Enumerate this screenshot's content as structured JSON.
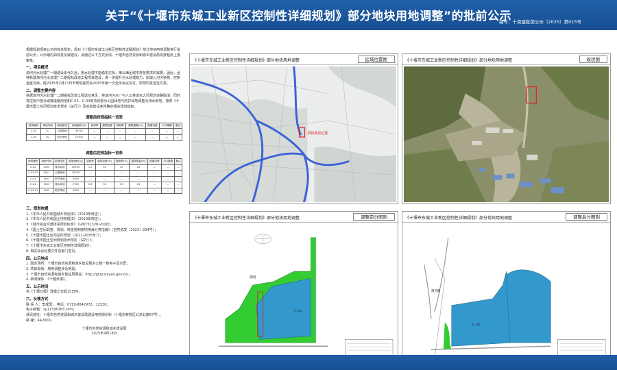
{
  "header": {
    "title": "关于“《十堰市东城工业新区控制性详细规划》部分地块用地调整”的批前公示",
    "doc_no": "编号：十资建批前公示（2025）第015号"
  },
  "left": {
    "intro": "根据规划项目公示的有关规定，现对《十堰市东城工业新区控制性详细规划》部分地块用地调整进行批前公示，公示期内如有意见或建议，请通过以下方式反馈，十堰市自然资源和城乡建设局将按程序上报审批。",
    "s1_title": "一、项目概况",
    "s1_text": "泗河污水处理厂一期建设年代久远，用水处理不能稳定达标，难以满足城市排放要求的需要，因此，亟待新建泗河污水处理厂二期提标改造工程项目建设，进一步提升污水处理能力，削减入河污染物，控制温室污染。经2025年2月17日市规划委员会2025年第一次全体会议议定，原则同意选址方案。",
    "s2_title": "二、调整主要内容",
    "s2_text": "依据泗河污水处理厂二期提标改造工程选址意见，将泗河污水厂与人工林道东之间规划道路取消，同时将控规中部分城镇道路用地和C-03、C-04地块的部分公园绿地与防护绿地调整为排水用地。按照《十堰市国土空间规划技术规定（试行）》及实际建设条件确定相关规划指标。",
    "table1_title": "调整前控规指标一览表",
    "table1_headers": [
      "地块编号",
      "用地代码",
      "用地性质",
      "用地面积(㎡)",
      "容积率",
      "建筑密度",
      "绿地率",
      "建筑限高(m)",
      "配建设施",
      "人口规模",
      "备注"
    ],
    "table1_rows": [
      [
        "C-03",
        "G1",
        "公园绿地",
        "49751",
        "—",
        "—",
        "—",
        "—",
        "—",
        "—",
        "—"
      ],
      [
        "C-04",
        "G2",
        "防护绿地",
        "15302",
        "—",
        "—",
        "—",
        "—",
        "—",
        "—",
        "—"
      ]
    ],
    "table2_title": "调整后控规指标一览表",
    "table2_headers": [
      "地块编号",
      "用地代码",
      "用地性质",
      "用地面积(㎡)",
      "容积率",
      "建筑密度(%)",
      "绿地率(%)",
      "建筑限高(m)",
      "配建设施",
      "人口规模",
      "备注"
    ],
    "table2_rows": [
      [
        "C-02",
        "1303",
        "排水用地",
        "29990",
        "1.0",
        "40",
        "30",
        "24",
        "—",
        "—",
        "—"
      ],
      [
        "C-03-01",
        "1401",
        "公园绿地",
        "32990",
        "—",
        "—",
        "—",
        "—",
        "—",
        "—",
        "—"
      ],
      [
        "C-03",
        "1402",
        "防护绿地",
        "3990",
        "—",
        "—",
        "—",
        "—",
        "—",
        "—",
        "—"
      ],
      [
        "C-04",
        "1303",
        "排水用地",
        "9720",
        "0.8",
        "50",
        "30",
        "24",
        "—",
        "—",
        "—"
      ],
      [
        "C-04-01",
        "1402",
        "防护绿地",
        "5990",
        "—",
        "—",
        "—",
        "—",
        "—",
        "—",
        "—"
      ]
    ],
    "s3_title": "三、规划依据",
    "s3_items": [
      "1.《中华人民共和国城乡规划法》（2019年修正）；",
      "2.《中华人民共和国土地管理法》（2019年修正）；",
      "3.《城市综合交通体系规划标准》（GB/T51328-2018）；",
      "4.《国土空间调查、规划、用途管制用地用海分类指南》（自然资发〔2023〕234号）；",
      "5.《十堰市国土空间总体规划（2021-2035年）》；",
      "6.《十堰市国土空间规划技术规定（试行）》；",
      "7.《十堰市东城工业新区控制性详细规划》；",
      "8. 相关会议纪要文件及部门意见。"
    ],
    "s4_title": "四、公示地点",
    "s4_items": [
      "1. 固定场所：十堰市自然资源和城乡建设局办公楼一楼电子显示屏；",
      "2. 项目现场：用地调整涉及地段；",
      "3. 十堰市自然资源和城乡建设局网站：http://gtzy.shiyan.gov.cn/；",
      "4. 新闻媒体：《十堰日报》。"
    ],
    "s5_title": "五、公示时间",
    "s5_text": "自《十堰日报》登报之日起15日内。",
    "s6_title": "六、反馈方式",
    "s6_items": [
      "联 系 人：李成国；        电话：0719-8642972，12336；",
      "电子邮箱：sy12336163.com；",
      "通讯地址：十堰市自然资源和城乡建设局建设用地规划科（十堰市茅箭区北京北路67号）；",
      "邮    编：442000。"
    ],
    "sign_org": "十堰市自然资源和城乡建设局",
    "sign_date": "2025年4月18日"
  },
  "panels": {
    "p1_title": "《十堰市东城工业新区控制性详细规划》部分地块用地调整",
    "p1_label": "区域位置图",
    "p1_marker": "项目地块位置",
    "p2_title": "《十堰市东城工业新区控制性详细规划》部分地块用地调整",
    "p2_label": "现状图",
    "p3_title": "《十堰市东城工业新区控制性详细规划》部分地块用地调整",
    "p3_label": "调整前分图则",
    "p3_parcel_a": "C-04",
    "p3_road": "泗河",
    "p4_title": "《十堰市东城工业新区控制性详细规划》部分地块用地调整",
    "p4_label": "调整后分图则",
    "p4_parcel_a": "C-04",
    "p4_road": "泗河路"
  },
  "colors": {
    "header": "#1f5fa8",
    "green": "#33cc33",
    "blue": "#3399cc",
    "road": "#3d63d8"
  }
}
